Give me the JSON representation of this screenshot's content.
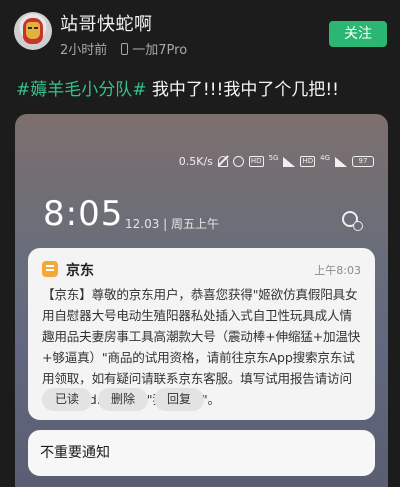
{
  "post": {
    "username": "站哥快蛇啊",
    "time_ago": "2小时前",
    "device": "一加7Pro",
    "follow_label": "关注",
    "hashtag": "#薅羊毛小分队#",
    "text": " 我中了!!!我中了个几把!!"
  },
  "screenshot": {
    "status_bar": {
      "speed": "0.5K/s",
      "net_label": "5G",
      "net_label_2": "4G",
      "battery": "97"
    },
    "lock": {
      "time": "8:05",
      "date": "12.03 | 周五上午"
    },
    "notification": {
      "app_name": "京东",
      "time": "上午8:03",
      "body": "【京东】尊敬的京东用户，恭喜您获得\"姬欲仿真假阳具女用自慰器大号电动生殖阳器私处插入式自卫性玩具成人情趣用品夫妻房事工具高潮款大号（震动棒+伸缩猛+加温快+够逼真）\"商品的试用资格，请前往京东App搜索京东试用领取，如有疑问请联系京东客服。填写试用报告请访问 trial.m.jd.com 下 \"我的试用\"。",
      "actions": [
        "已读",
        "删除",
        "回复"
      ]
    },
    "unimportant_label": "不重要通知"
  },
  "colors": {
    "accent_green": "#2bb673",
    "hashtag_green": "#37c08a",
    "app_icon": "#f2a93a"
  }
}
